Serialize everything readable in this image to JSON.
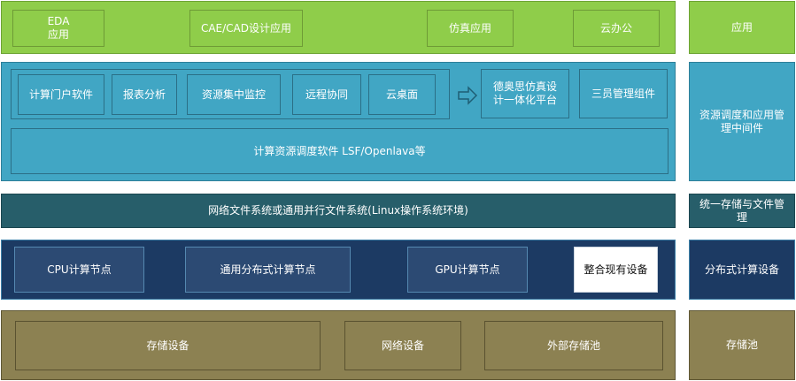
{
  "layers": {
    "application": {
      "items": [
        "EDA\n应用",
        "CAE/CAD设计应用",
        "仿真应用",
        "云办公"
      ],
      "side_label": "应用"
    },
    "middleware": {
      "group_items": [
        "计算门户软件",
        "报表分析",
        "资源集中监控",
        "远程协同",
        "云桌面"
      ],
      "platform": "德奥思仿真设计一体化平台",
      "component": "三员管理组件",
      "scheduler": "计算资源调度软件 LSF/Openlava等",
      "side_label": "资源调度和应用管理中间件"
    },
    "filesystem": {
      "label": "网络文件系统或通用并行文件系统(Linux操作系统环境)",
      "side_label": "统一存储与文件管理"
    },
    "compute": {
      "items": [
        "CPU计算节点",
        "通用分布式计算节点",
        "GPU计算节点",
        "整合现有设备"
      ],
      "side_label": "分布式计算设备"
    },
    "storage": {
      "items": [
        "存储设备",
        "网络设备",
        "外部存储池"
      ],
      "side_label": "存储池"
    }
  },
  "colors": {
    "application": "#8fcd4a",
    "middleware": "#41a6c4",
    "filesystem": "#275e6a",
    "compute": "#1c3a63",
    "storage": "#8c8152"
  }
}
